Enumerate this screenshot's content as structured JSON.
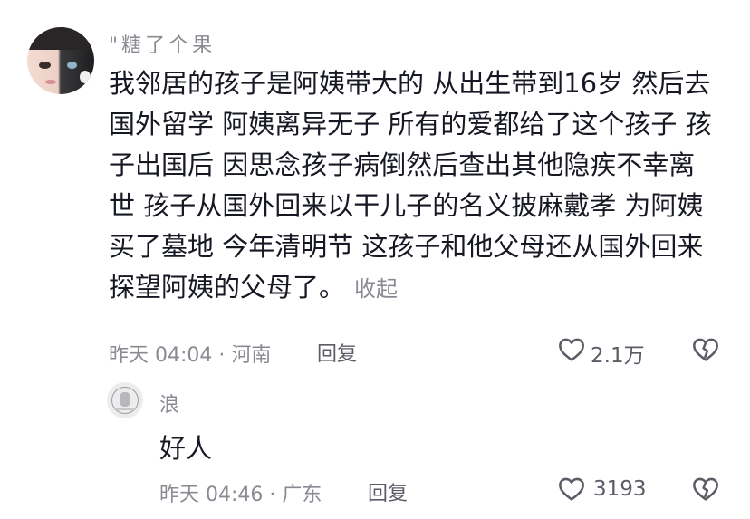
{
  "comment": {
    "username": "\"糖了个果",
    "lines": [
      "我邻居的孩子是阿姨带大的 从出生带到16岁 然后去",
      "国外留学 阿姨离异无子 所有的爱都给了这个孩子 孩",
      "子出国后 因思念孩子病倒然后查出其他隐疾不幸离",
      "世 孩子从国外回来以干儿子的名义披麻戴孝 为阿姨",
      "买了墓地 今年清明节 这孩子和他父母还从国外回来",
      "探望阿姨的父母了。"
    ],
    "collapse_label": "收起",
    "meta": "昨天 04:04 · 河南",
    "reply_label": "回复",
    "like_count": "2.1万"
  },
  "reply": {
    "username": "浪",
    "text": "好人",
    "meta": "昨天 04:46 · 广东",
    "reply_label": "回复",
    "like_count": "3193"
  },
  "icons": {
    "like": "heart-outline-icon",
    "dislike": "broken-heart-icon"
  },
  "colors": {
    "text_primary": "#161823",
    "text_secondary": "#8a8a92",
    "icon": "#5b5c66"
  }
}
